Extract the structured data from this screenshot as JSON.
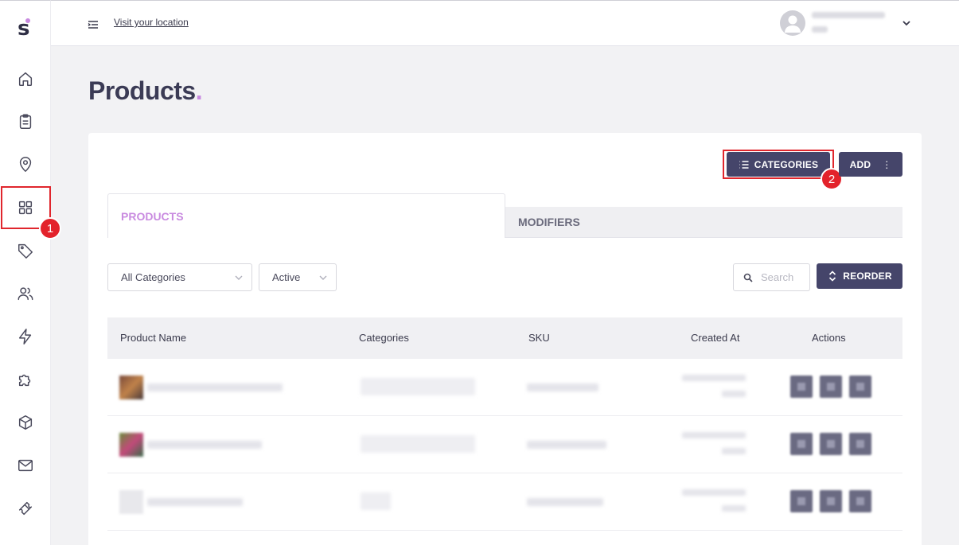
{
  "app": {
    "logo_letter": "s",
    "brand_accent": "#c98be0",
    "primary_dark": "#45456a",
    "annotation_red": "#e0262d"
  },
  "sidebar": {
    "items": [
      {
        "icon": "home-icon"
      },
      {
        "icon": "clipboard-icon"
      },
      {
        "icon": "location-pin-icon"
      },
      {
        "icon": "grid-icon",
        "active": true
      },
      {
        "icon": "tag-icon"
      },
      {
        "icon": "users-icon"
      },
      {
        "icon": "lightning-icon"
      },
      {
        "icon": "puzzle-icon"
      },
      {
        "icon": "box-icon"
      },
      {
        "icon": "mail-icon"
      },
      {
        "icon": "ticket-icon"
      }
    ]
  },
  "annotations": {
    "step1": "1",
    "step2": "2"
  },
  "topbar": {
    "visit_link": "Visit your location"
  },
  "page": {
    "title": "Products",
    "title_dot": "."
  },
  "toolbar": {
    "categories_label": "CATEGORIES",
    "add_label": "ADD",
    "add_more": "⋮",
    "reorder_label": "REORDER"
  },
  "tabs": [
    {
      "label": "PRODUCTS",
      "active": true
    },
    {
      "label": "MODIFIERS",
      "active": false
    }
  ],
  "filters": {
    "category_value": "All Categories",
    "status_value": "Active",
    "search_placeholder": "Search"
  },
  "table": {
    "columns": [
      "Product Name",
      "Categories",
      "SKU",
      "Created At",
      "Actions"
    ]
  }
}
